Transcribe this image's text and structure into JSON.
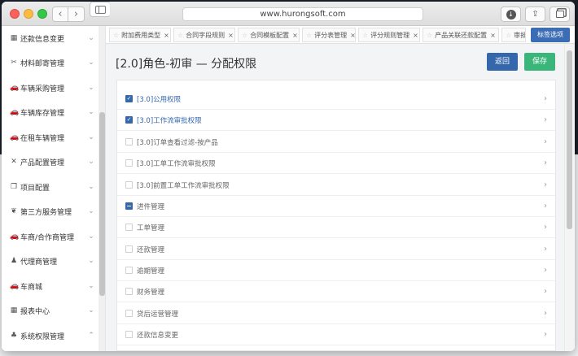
{
  "browser": {
    "url": "www.hurongsoft.com",
    "back_glyph": "‹",
    "forward_glyph": "›",
    "download_glyph": "↓",
    "share_glyph": "⇪",
    "icons": [
      "back-icon",
      "forward-icon",
      "sidebar-toggle-icon",
      "download-icon",
      "share-icon",
      "tabs-icon"
    ]
  },
  "sidebar": {
    "items": [
      {
        "label": "还款信息变更",
        "icon": "calendar-icon",
        "glyph": "▦",
        "chevron": "⌄"
      },
      {
        "label": "材料邮寄管理",
        "icon": "tools-icon",
        "glyph": "✂",
        "chevron": "⌄"
      },
      {
        "label": "车辆采购管理",
        "icon": "car-icon",
        "glyph": "🚗",
        "chevron": "⌄"
      },
      {
        "label": "车辆库存管理",
        "icon": "car-icon",
        "glyph": "🚗",
        "chevron": "⌄"
      },
      {
        "label": "在租车辆管理",
        "icon": "car-icon",
        "glyph": "🚗",
        "chevron": "⌄"
      },
      {
        "label": "产品配置管理",
        "icon": "config-icon",
        "glyph": "✕",
        "chevron": "⌄"
      },
      {
        "label": "项目配置",
        "icon": "copy-icon",
        "glyph": "❐",
        "chevron": "⌄"
      },
      {
        "label": "第三方服务管理",
        "icon": "gift-icon",
        "glyph": "❦",
        "chevron": "⌄"
      },
      {
        "label": "车商/合作商管理",
        "icon": "car-icon",
        "glyph": "🚗",
        "chevron": "⌄"
      },
      {
        "label": "代理商管理",
        "icon": "user-icon",
        "glyph": "♟",
        "chevron": "⌄"
      },
      {
        "label": "车商城",
        "icon": "car-icon",
        "glyph": "🚗",
        "chevron": "⌄"
      },
      {
        "label": "报表中心",
        "icon": "calendar-icon",
        "glyph": "▦",
        "chevron": "⌄"
      },
      {
        "label": "系统权限管理",
        "icon": "sitemap-icon",
        "glyph": "♣",
        "chevron": "⌃"
      }
    ]
  },
  "tabs": {
    "items": [
      {
        "label": "附加费用类型",
        "star": "☆",
        "close": "×"
      },
      {
        "label": "合同字段规则",
        "star": "☆",
        "close": "×"
      },
      {
        "label": "合同模板配置",
        "star": "☆",
        "close": "×"
      },
      {
        "label": "评分表管理",
        "star": "☆",
        "close": "×"
      },
      {
        "label": "评分规则管理",
        "star": "☆",
        "close": "×"
      },
      {
        "label": "产品关联还款配置",
        "star": "☆",
        "close": "×"
      },
      {
        "label": "审批",
        "star": "☆",
        "close": ""
      }
    ],
    "more_label": "标签选项"
  },
  "page": {
    "title": "[2.0]角色-初审 — 分配权限",
    "back_label": "返回",
    "save_label": "保存"
  },
  "permissions": {
    "chevron": "›",
    "rows": [
      {
        "label": "[3.0]公用权限",
        "state": "checked"
      },
      {
        "label": "[3.0]工作流审批权限",
        "state": "checked"
      },
      {
        "label": "[3.0]订单查看过滤-按产品",
        "state": "unchecked"
      },
      {
        "label": "[3.0]工单工作流审批权限",
        "state": "unchecked"
      },
      {
        "label": "[3.0]前置工单工作流审批权限",
        "state": "unchecked"
      },
      {
        "label": "进件管理",
        "state": "partial"
      },
      {
        "label": "工单管理",
        "state": "unchecked"
      },
      {
        "label": "还款管理",
        "state": "unchecked"
      },
      {
        "label": "逾期管理",
        "state": "unchecked"
      },
      {
        "label": "财务管理",
        "state": "unchecked"
      },
      {
        "label": "贷后运营管理",
        "state": "unchecked"
      },
      {
        "label": "还款信息变更",
        "state": "unchecked"
      }
    ]
  },
  "colors": {
    "primary": "#3567ac",
    "save": "#3bb67b",
    "tab_more": "#3b6db4"
  }
}
